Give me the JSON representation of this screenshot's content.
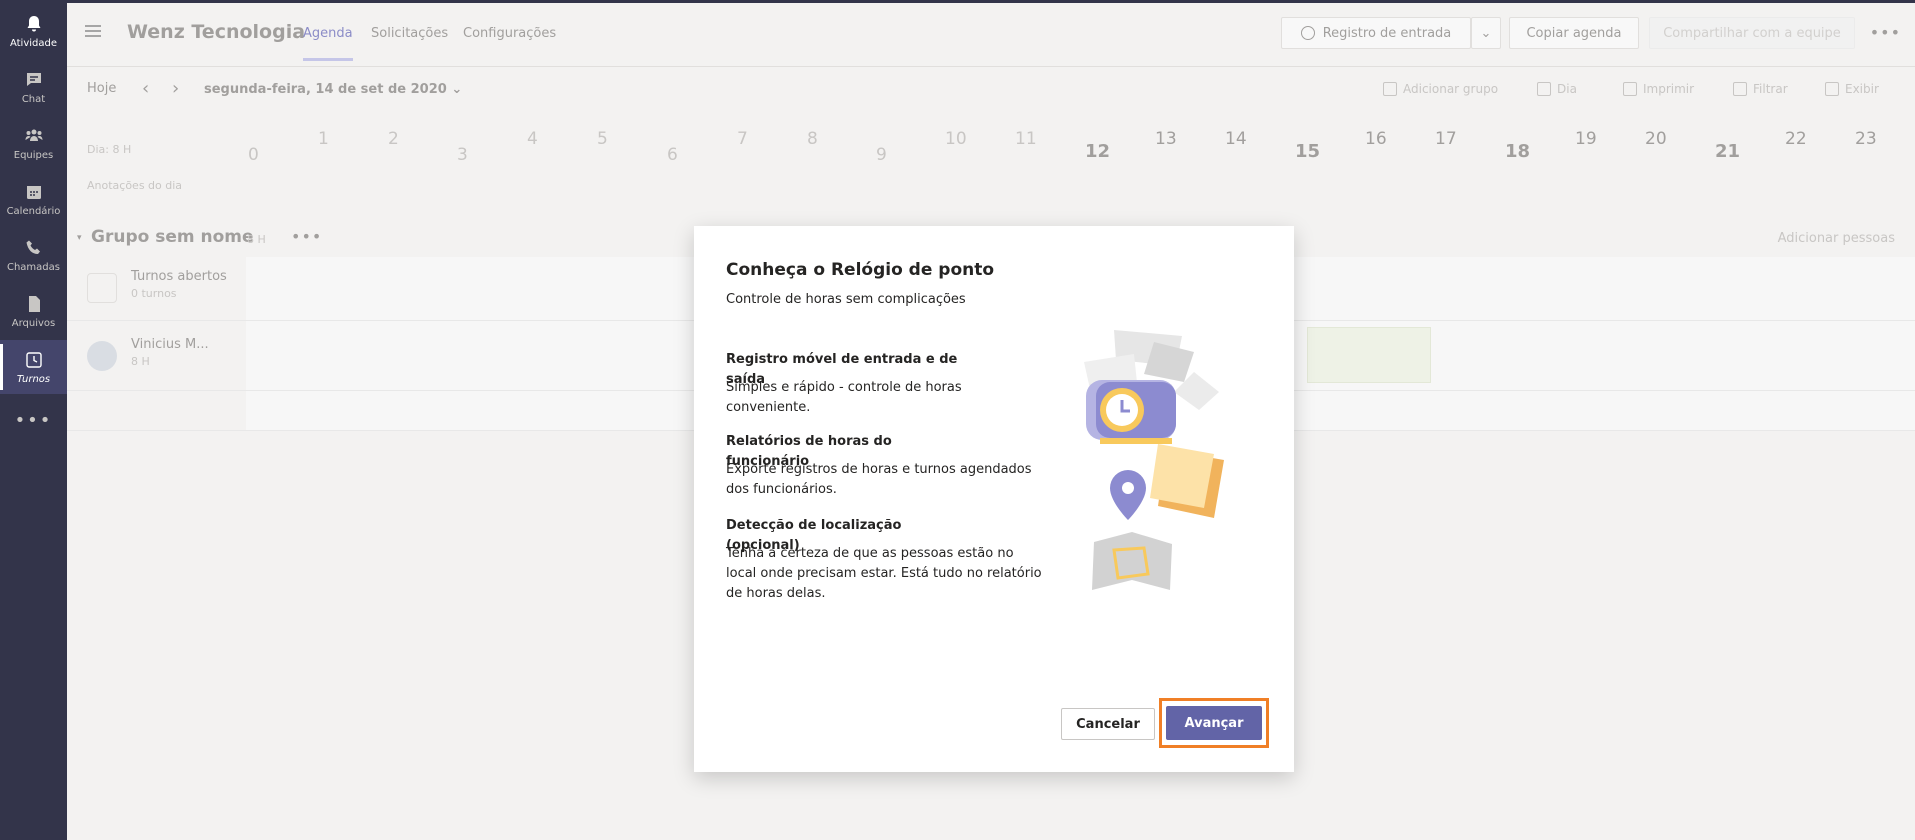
{
  "rail": {
    "items": [
      {
        "label": "Atividade",
        "icon": "bell-icon"
      },
      {
        "label": "Chat",
        "icon": "chat-icon"
      },
      {
        "label": "Equipes",
        "icon": "teams-icon"
      },
      {
        "label": "Calendário",
        "icon": "calendar-icon"
      },
      {
        "label": "Chamadas",
        "icon": "phone-icon"
      },
      {
        "label": "Arquivos",
        "icon": "file-icon"
      },
      {
        "label": "Turnos",
        "icon": "clock-icon"
      }
    ],
    "more": "•••"
  },
  "header": {
    "team_name": "Wenz Tecnologia",
    "tabs": [
      "Agenda",
      "Solicitações",
      "Configurações"
    ],
    "clock_in": "Registro de entrada",
    "copy_schedule": "Copiar agenda",
    "share": "Compartilhar com a equipe",
    "more": "•••"
  },
  "subbar": {
    "today": "Hoje",
    "date": "segunda-feira, 14 de set de 2020",
    "add_group": "Adicionar grupo",
    "view": "Dia",
    "print": "Imprimir",
    "filter": "Filtrar",
    "show": "Exibir"
  },
  "timeline": {
    "day_label": "Dia: 8 H",
    "notes_label": "Anotações do dia",
    "hours": [
      "0",
      "1",
      "2",
      "3",
      "4",
      "5",
      "6",
      "7",
      "8",
      "9",
      "10",
      "11",
      "12",
      "13",
      "14",
      "15",
      "16",
      "17",
      "18",
      "19",
      "20",
      "21",
      "22",
      "23"
    ]
  },
  "group": {
    "name": "Grupo sem nome",
    "hours": "8 H",
    "add_people": "Adicionar pessoas",
    "rows": [
      {
        "name": "Turnos abertos",
        "sub": "0 turnos"
      },
      {
        "name": "Vinicius M...",
        "sub": "8 H"
      }
    ]
  },
  "modal": {
    "title": "Conheça o Relógio de ponto",
    "subtitle": "Controle de horas sem complicações",
    "features": [
      {
        "title": "Registro móvel de entrada e de saída",
        "desc": "Simples e rápido - controle de horas conveniente."
      },
      {
        "title": "Relatórios de horas do funcionário",
        "desc": "Exporte registros de horas e turnos agendados dos funcionários."
      },
      {
        "title": "Detecção de localização (opcional)",
        "desc": "Tenha a certeza de que as pessoas estão no local onde precisam estar. Está tudo no relatório de horas delas."
      }
    ],
    "cancel": "Cancelar",
    "next": "Avançar"
  },
  "colors": {
    "rail": "#33344a",
    "accent": "#6264a7",
    "highlight": "#f07f26"
  }
}
